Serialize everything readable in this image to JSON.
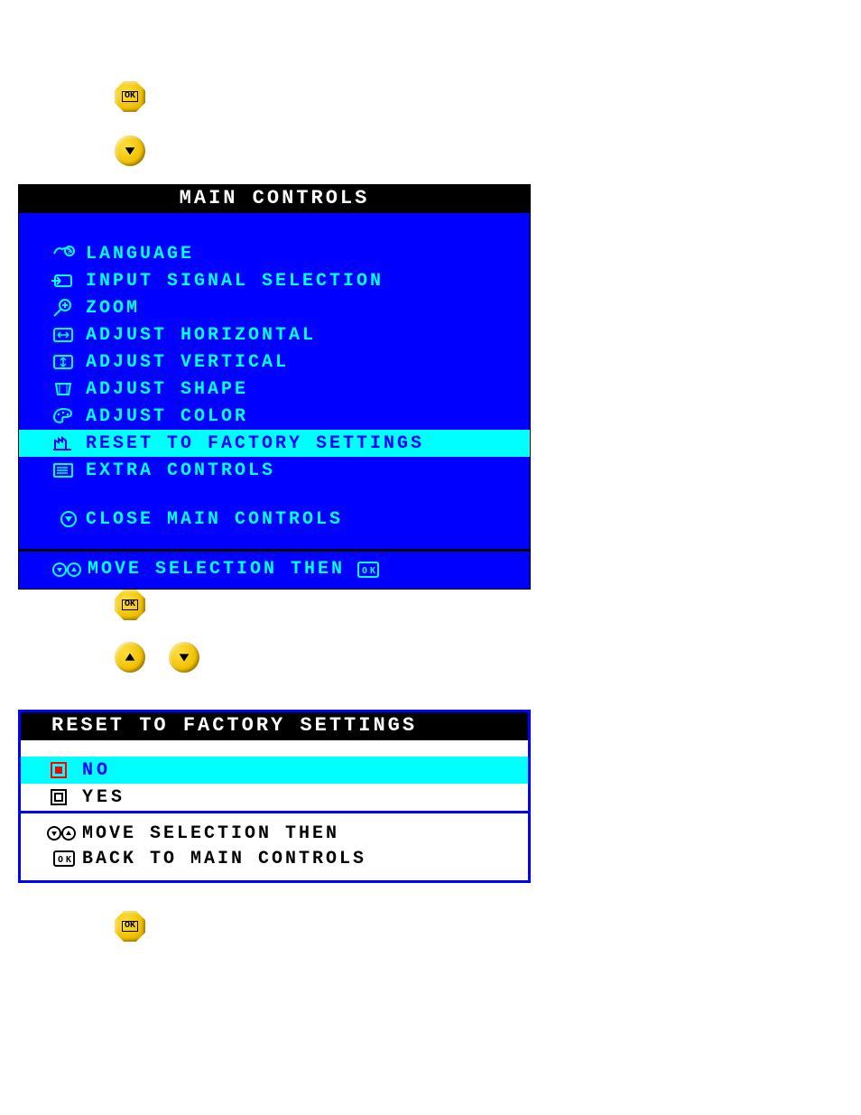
{
  "buttons": {
    "ok_label": "OK"
  },
  "panel1": {
    "title": "MAIN CONTROLS",
    "items": [
      {
        "label": "LANGUAGE"
      },
      {
        "label": "INPUT SIGNAL SELECTION"
      },
      {
        "label": "ZOOM"
      },
      {
        "label": "ADJUST HORIZONTAL"
      },
      {
        "label": "ADJUST VERTICAL"
      },
      {
        "label": "ADJUST SHAPE"
      },
      {
        "label": "ADJUST COLOR"
      },
      {
        "label": "RESET TO FACTORY SETTINGS"
      },
      {
        "label": "EXTRA CONTROLS"
      }
    ],
    "close_label": "CLOSE MAIN CONTROLS",
    "footer": "MOVE SELECTION THEN"
  },
  "panel2": {
    "title": "RESET TO FACTORY SETTINGS",
    "options": [
      {
        "label": "NO"
      },
      {
        "label": "YES"
      }
    ],
    "footer_line1": "MOVE SELECTION THEN",
    "footer_line2": "BACK TO MAIN CONTROLS"
  }
}
